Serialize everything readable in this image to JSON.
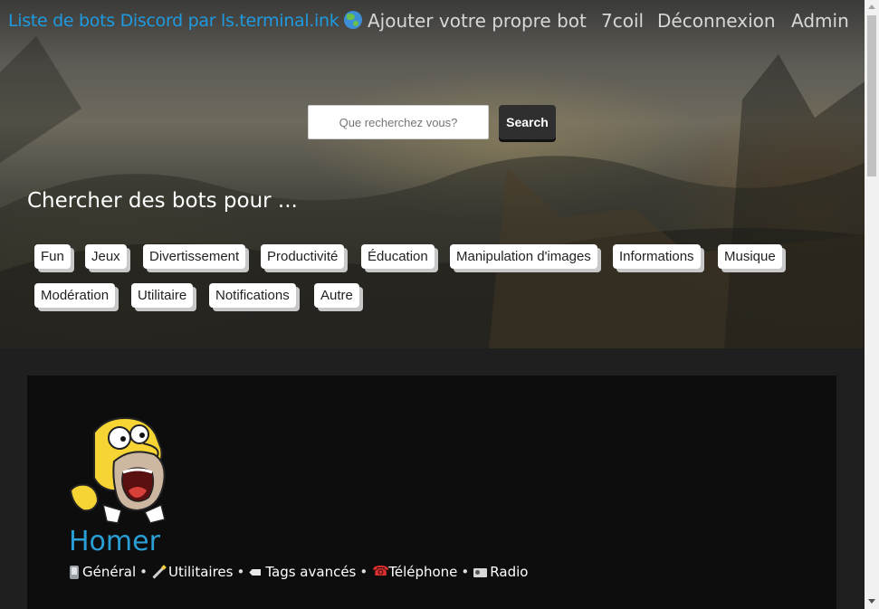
{
  "nav": {
    "brand": "Liste de bots Discord par ls.terminal.ink",
    "brand_icon": "globe-icon",
    "links": [
      "Ajouter votre propre bot",
      "7coil",
      "Déconnexion",
      "Admin"
    ]
  },
  "search": {
    "placeholder": "Que recherchez vous?",
    "button_label": "Search"
  },
  "heading": "Chercher des bots pour ...",
  "categories": [
    "Fun",
    "Jeux",
    "Divertissement",
    "Productivité",
    "Éducation",
    "Manipulation d'images",
    "Informations",
    "Musique",
    "Modération",
    "Utilitaire",
    "Notifications",
    "Autre"
  ],
  "bot": {
    "name": "Homer",
    "avatar": "homer-simpson-avatar",
    "tags": [
      {
        "icon": "phone-icon",
        "label": "Général"
      },
      {
        "icon": "wand-icon",
        "label": "Utilitaires"
      },
      {
        "icon": "label-tag-icon",
        "label": "Tags avancés"
      },
      {
        "icon": "telephone-icon",
        "label": "Téléphone"
      },
      {
        "icon": "radio-icon",
        "label": "Radio"
      }
    ],
    "separator": "•"
  },
  "colors": {
    "brand": "#1e9ae0",
    "bot_name": "#2a9fd6",
    "card_bg": "#0d0d0d",
    "page_bg": "#1f1f1f"
  }
}
